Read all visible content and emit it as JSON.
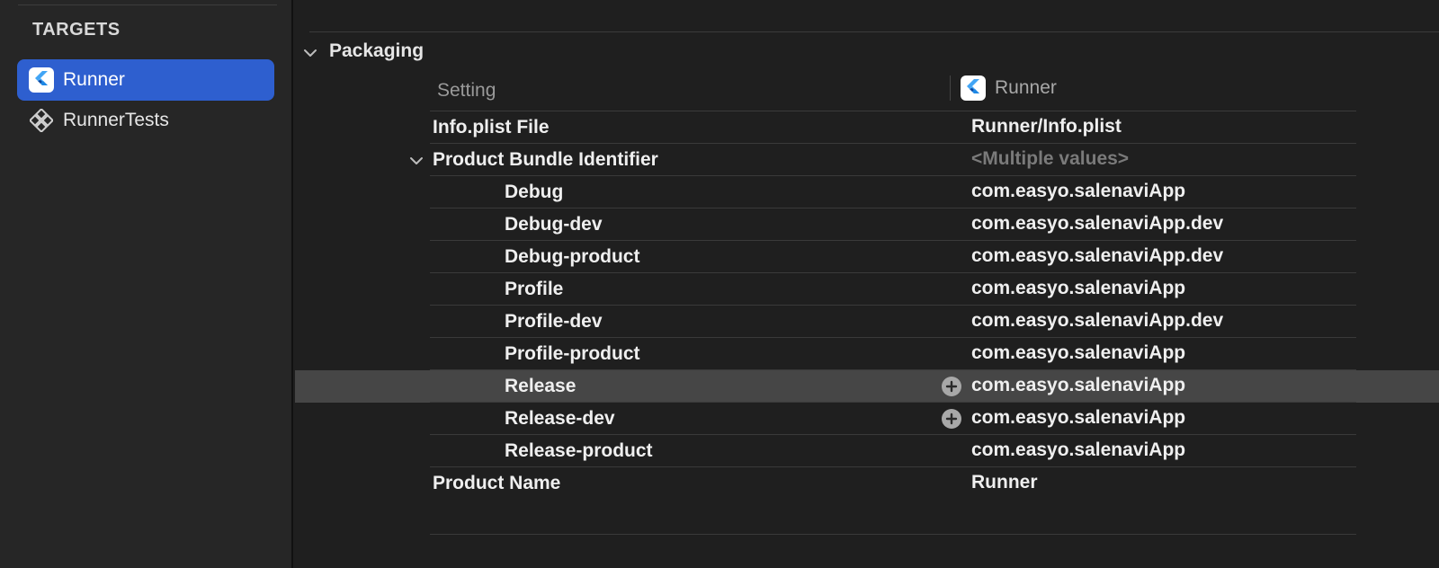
{
  "sidebar": {
    "header": "TARGETS",
    "targets": [
      {
        "label": "Runner",
        "icon": "flutter-icon",
        "selected": true
      },
      {
        "label": "RunnerTests",
        "icon": "test-target-icon",
        "selected": false
      }
    ]
  },
  "section": {
    "title": "Packaging",
    "columns": {
      "setting": "Setting",
      "target": "Runner"
    }
  },
  "rows": [
    {
      "setting": "Info.plist File",
      "value": "Runner/Info.plist"
    },
    {
      "setting": "Product Bundle Identifier",
      "value": "<Multiple values>"
    },
    {
      "setting": "Debug",
      "value": "com.easyo.salenaviApp"
    },
    {
      "setting": "Debug-dev",
      "value": "com.easyo.salenaviApp.dev"
    },
    {
      "setting": "Debug-product",
      "value": "com.easyo.salenaviApp.dev"
    },
    {
      "setting": "Profile",
      "value": "com.easyo.salenaviApp"
    },
    {
      "setting": "Profile-dev",
      "value": "com.easyo.salenaviApp.dev"
    },
    {
      "setting": "Profile-product",
      "value": "com.easyo.salenaviApp"
    },
    {
      "setting": "Release",
      "value": "com.easyo.salenaviApp"
    },
    {
      "setting": "Release-dev",
      "value": "com.easyo.salenaviApp"
    },
    {
      "setting": "Release-product",
      "value": "com.easyo.salenaviApp"
    },
    {
      "setting": "Product Name",
      "value": "Runner"
    }
  ],
  "colors": {
    "background": "#1f1f1f",
    "sidebar": "#262626",
    "selection": "#2e5fcf",
    "highlight_row": "#464646",
    "flutter_blue": "#42a5f5",
    "flutter_dark": "#0d47a1"
  }
}
